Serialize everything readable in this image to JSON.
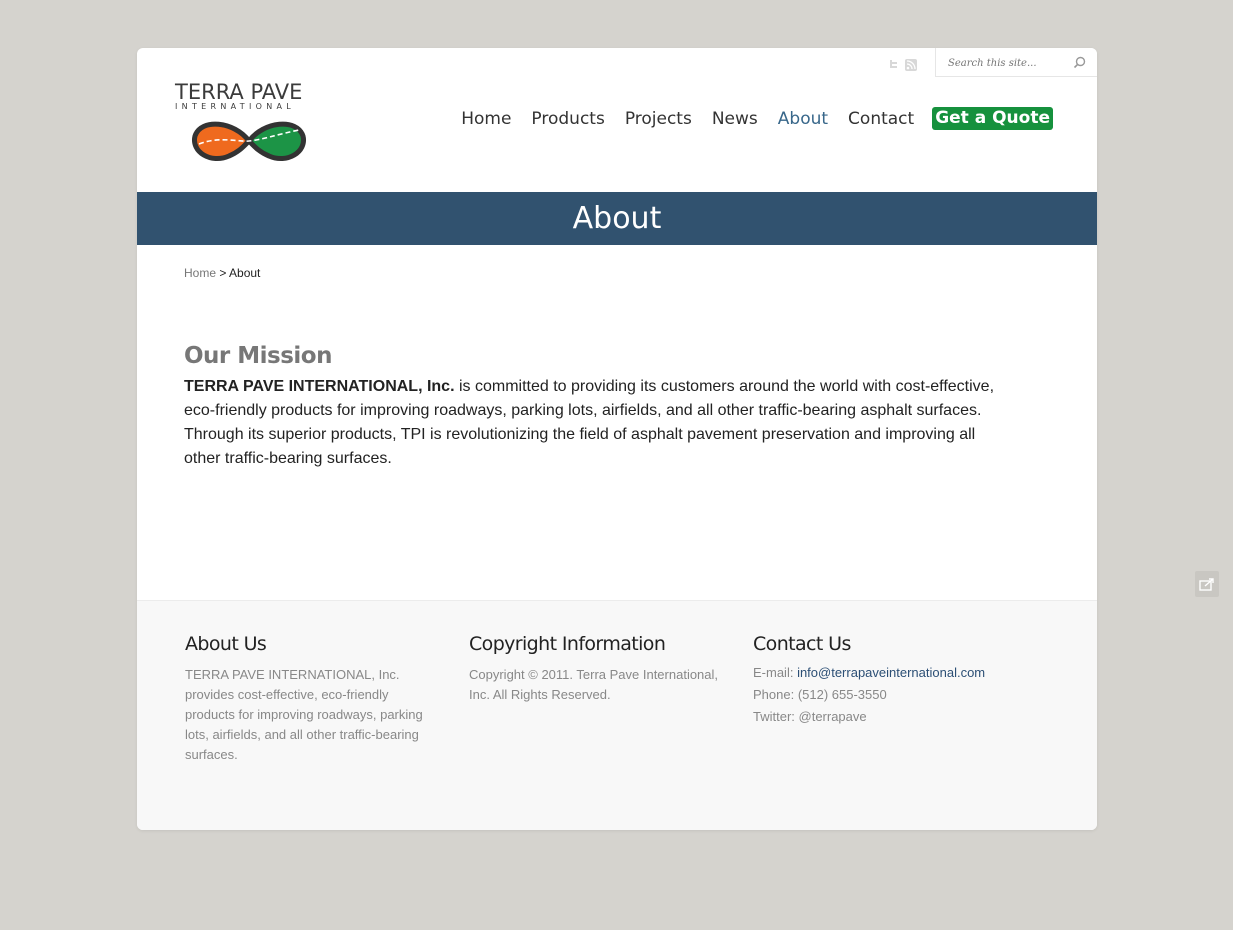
{
  "header": {
    "logo_title": "TERRA PAVE",
    "logo_subtitle": "INTERNATIONAL",
    "search_placeholder": "Search this site...",
    "nav": [
      {
        "label": "Home"
      },
      {
        "label": "Products"
      },
      {
        "label": "Projects"
      },
      {
        "label": "News"
      },
      {
        "label": "About",
        "active": true
      },
      {
        "label": "Contact"
      },
      {
        "label": "Get a Quote"
      }
    ],
    "social_icons": [
      "twitter-icon",
      "rss-icon"
    ]
  },
  "banner": {
    "title": "About"
  },
  "breadcrumb": {
    "home": "Home",
    "separator": " > ",
    "current": "About"
  },
  "main": {
    "mission_title": "Our Mission",
    "mission_company": "TERRA PAVE INTERNATIONAL, Inc.",
    "mission_text": " is committed to providing its customers around the world with cost-effective, eco-friendly products for improving roadways, parking lots, airfields, and all other traffic-bearing asphalt surfaces. Through its superior products, TPI is revolutionizing the field of asphalt pavement preservation and improving all other traffic-bearing surfaces."
  },
  "footer": {
    "about": {
      "title": "About Us",
      "text": "TERRA PAVE INTERNATIONAL, Inc. provides cost-effective, eco-friendly products for improving roadways, parking lots, airfields, and all other traffic-bearing surfaces."
    },
    "copyright": {
      "title": "Copyright Information",
      "text": "Copyright © 2011. Terra Pave International, Inc. All Rights Reserved."
    },
    "contact": {
      "title": "Contact Us",
      "email_label": "E-mail: ",
      "email": "info@terrapaveinternational.com",
      "phone": "Phone: (512) 655-3550",
      "twitter": "Twitter: @terrapave"
    }
  },
  "colors": {
    "banner": "#31526f",
    "quote_button": "#16913d",
    "active_nav": "#38678a",
    "logo_orange": "#ef6a1e",
    "logo_green": "#1c9446"
  }
}
